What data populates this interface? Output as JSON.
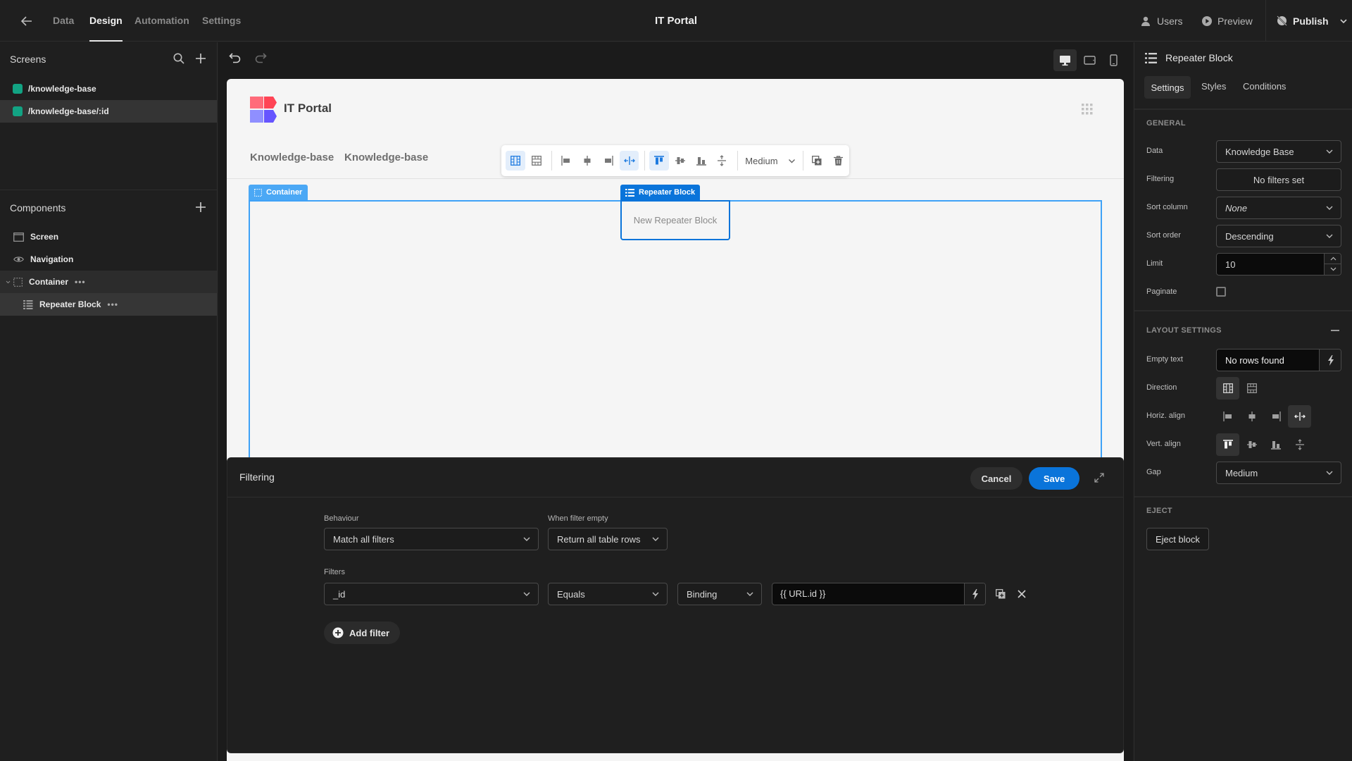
{
  "topbar": {
    "back_icon": "arrow-left-icon",
    "tabs": [
      {
        "label": "Data",
        "active": false
      },
      {
        "label": "Design",
        "active": true
      },
      {
        "label": "Automation",
        "active": false
      },
      {
        "label": "Settings",
        "active": false
      }
    ],
    "app_title": "IT Portal",
    "users_label": "Users",
    "preview_label": "Preview",
    "publish_label": "Publish"
  },
  "screens": {
    "title": "Screens",
    "items": [
      {
        "route": "/knowledge-base",
        "selected": false,
        "color": "#12a383"
      },
      {
        "route": "/knowledge-base/:id",
        "selected": true,
        "color": "#12a383"
      }
    ]
  },
  "components": {
    "title": "Components",
    "items": [
      {
        "label": "Screen",
        "icon": "screen-icon"
      },
      {
        "label": "Navigation",
        "icon": "eye-icon"
      },
      {
        "label": "Container",
        "icon": "container-icon"
      },
      {
        "label": "Repeater Block",
        "icon": "list-icon"
      }
    ]
  },
  "canvas": {
    "device_modes": [
      "desktop",
      "tablet",
      "mobile"
    ],
    "active_device": "desktop",
    "site_title": "IT Portal",
    "nav_links": [
      "Knowledge-base",
      "Knowledge-base"
    ],
    "toolbar_gap": "Medium",
    "container_tag": "Container",
    "repeater_tag": "Repeater Block",
    "repeater_placeholder": "New Repeater Block"
  },
  "filter_drawer": {
    "title": "Filtering",
    "cancel_label": "Cancel",
    "save_label": "Save",
    "behaviour_label": "Behaviour",
    "behaviour_value": "Match all filters",
    "when_empty_label": "When filter empty",
    "when_empty_value": "Return all table rows",
    "filters_label": "Filters",
    "filters": [
      {
        "field": "_id",
        "operator": "Equals",
        "type": "Binding",
        "value": "{{ URL.id }}"
      }
    ],
    "add_filter_label": "Add filter"
  },
  "settings_panel": {
    "component_name": "Repeater Block",
    "tabs": [
      "Settings",
      "Styles",
      "Conditions"
    ],
    "active_tab": "Settings",
    "general_title": "GENERAL",
    "data_label": "Data",
    "data_value": "Knowledge Base",
    "filtering_label": "Filtering",
    "filtering_value": "No filters set",
    "sort_column_label": "Sort column",
    "sort_column_value": "None",
    "sort_order_label": "Sort order",
    "sort_order_value": "Descending",
    "limit_label": "Limit",
    "limit_value": "10",
    "paginate_label": "Paginate",
    "paginate_checked": false,
    "layout_title": "LAYOUT SETTINGS",
    "empty_text_label": "Empty text",
    "empty_text_value": "No rows found",
    "direction_label": "Direction",
    "horiz_align_label": "Horiz. align",
    "vert_align_label": "Vert. align",
    "gap_label": "Gap",
    "gap_value": "Medium",
    "eject_title": "EJECT",
    "eject_label": "Eject block",
    "accent_color": "#0a74da"
  }
}
